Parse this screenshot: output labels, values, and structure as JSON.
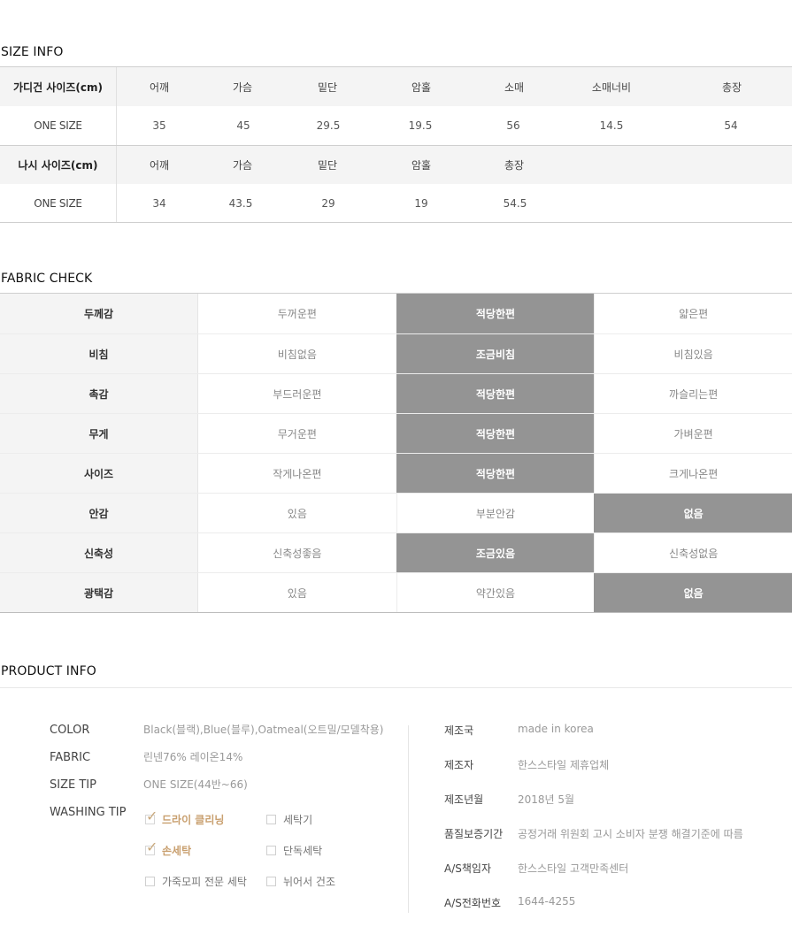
{
  "size_info": {
    "title": "SIZE INFO",
    "cardigan": {
      "label": "가디건 사이즈(cm)",
      "columns": [
        "어깨",
        "가슴",
        "밑단",
        "암홀",
        "소매",
        "소매너비",
        "총장"
      ],
      "row_label": "ONE SIZE",
      "values": [
        "35",
        "45",
        "29.5",
        "19.5",
        "56",
        "14.5",
        "54"
      ]
    },
    "sleeveless": {
      "label": "나시 사이즈(cm)",
      "columns": [
        "어깨",
        "가슴",
        "밑단",
        "암홀",
        "총장"
      ],
      "row_label": "ONE SIZE",
      "values": [
        "34",
        "43.5",
        "29",
        "19",
        "54.5"
      ]
    }
  },
  "fabric_check": {
    "title": "FABRIC CHECK",
    "rows": [
      {
        "label": "두께감",
        "options": [
          "두꺼운편",
          "적당한편",
          "얇은편"
        ],
        "selected": 1
      },
      {
        "label": "비침",
        "options": [
          "비침없음",
          "조금비침",
          "비침있음"
        ],
        "selected": 1
      },
      {
        "label": "촉감",
        "options": [
          "부드러운편",
          "적당한편",
          "까슬리는편"
        ],
        "selected": 1
      },
      {
        "label": "무게",
        "options": [
          "무거운편",
          "적당한편",
          "가벼운편"
        ],
        "selected": 1
      },
      {
        "label": "사이즈",
        "options": [
          "작게나온편",
          "적당한편",
          "크게나온편"
        ],
        "selected": 1
      },
      {
        "label": "안감",
        "options": [
          "있음",
          "부분안감",
          "없음"
        ],
        "selected": 2
      },
      {
        "label": "신축성",
        "options": [
          "신축성좋음",
          "조금있음",
          "신축성없음"
        ],
        "selected": 1
      },
      {
        "label": "광택감",
        "options": [
          "있음",
          "약간있음",
          "없음"
        ],
        "selected": 2
      }
    ],
    "selected_color": "#949494"
  },
  "product_info": {
    "title": "PRODUCT INFO",
    "color_label": "COLOR",
    "color_value": "Black(블랙),Blue(블루),Oatmeal(오트밀/모델착용)",
    "fabric_label": "FABRIC",
    "fabric_value": "린넨76% 레이온14%",
    "size_tip_label": "SIZE TIP",
    "size_tip_value": "ONE SIZE(44반~66)",
    "washing_tip_label": "WASHING TIP",
    "washing": [
      {
        "label": "드라이 클리닝",
        "checked": true
      },
      {
        "label": "세탁기",
        "checked": false
      },
      {
        "label": "손세탁",
        "checked": true
      },
      {
        "label": "단독세탁",
        "checked": false
      },
      {
        "label": "가죽모피 전문 세탁",
        "checked": false
      },
      {
        "label": "뉘어서 건조",
        "checked": false
      }
    ],
    "details": [
      {
        "label": "제조국",
        "value": "made in korea"
      },
      {
        "label": "제조자",
        "value": "한스스타일 제휴업체"
      },
      {
        "label": "제조년월",
        "value": "2018년 5월"
      },
      {
        "label": "품질보증기간",
        "value": "공정거래 위원회 고시 소비자 분쟁 해결기준에 따름"
      },
      {
        "label": "A/S책임자",
        "value": "한스스타일 고객만족센터"
      },
      {
        "label": "A/S전화번호",
        "value": "1644-4255"
      }
    ],
    "accent_color": "#c9a070"
  }
}
